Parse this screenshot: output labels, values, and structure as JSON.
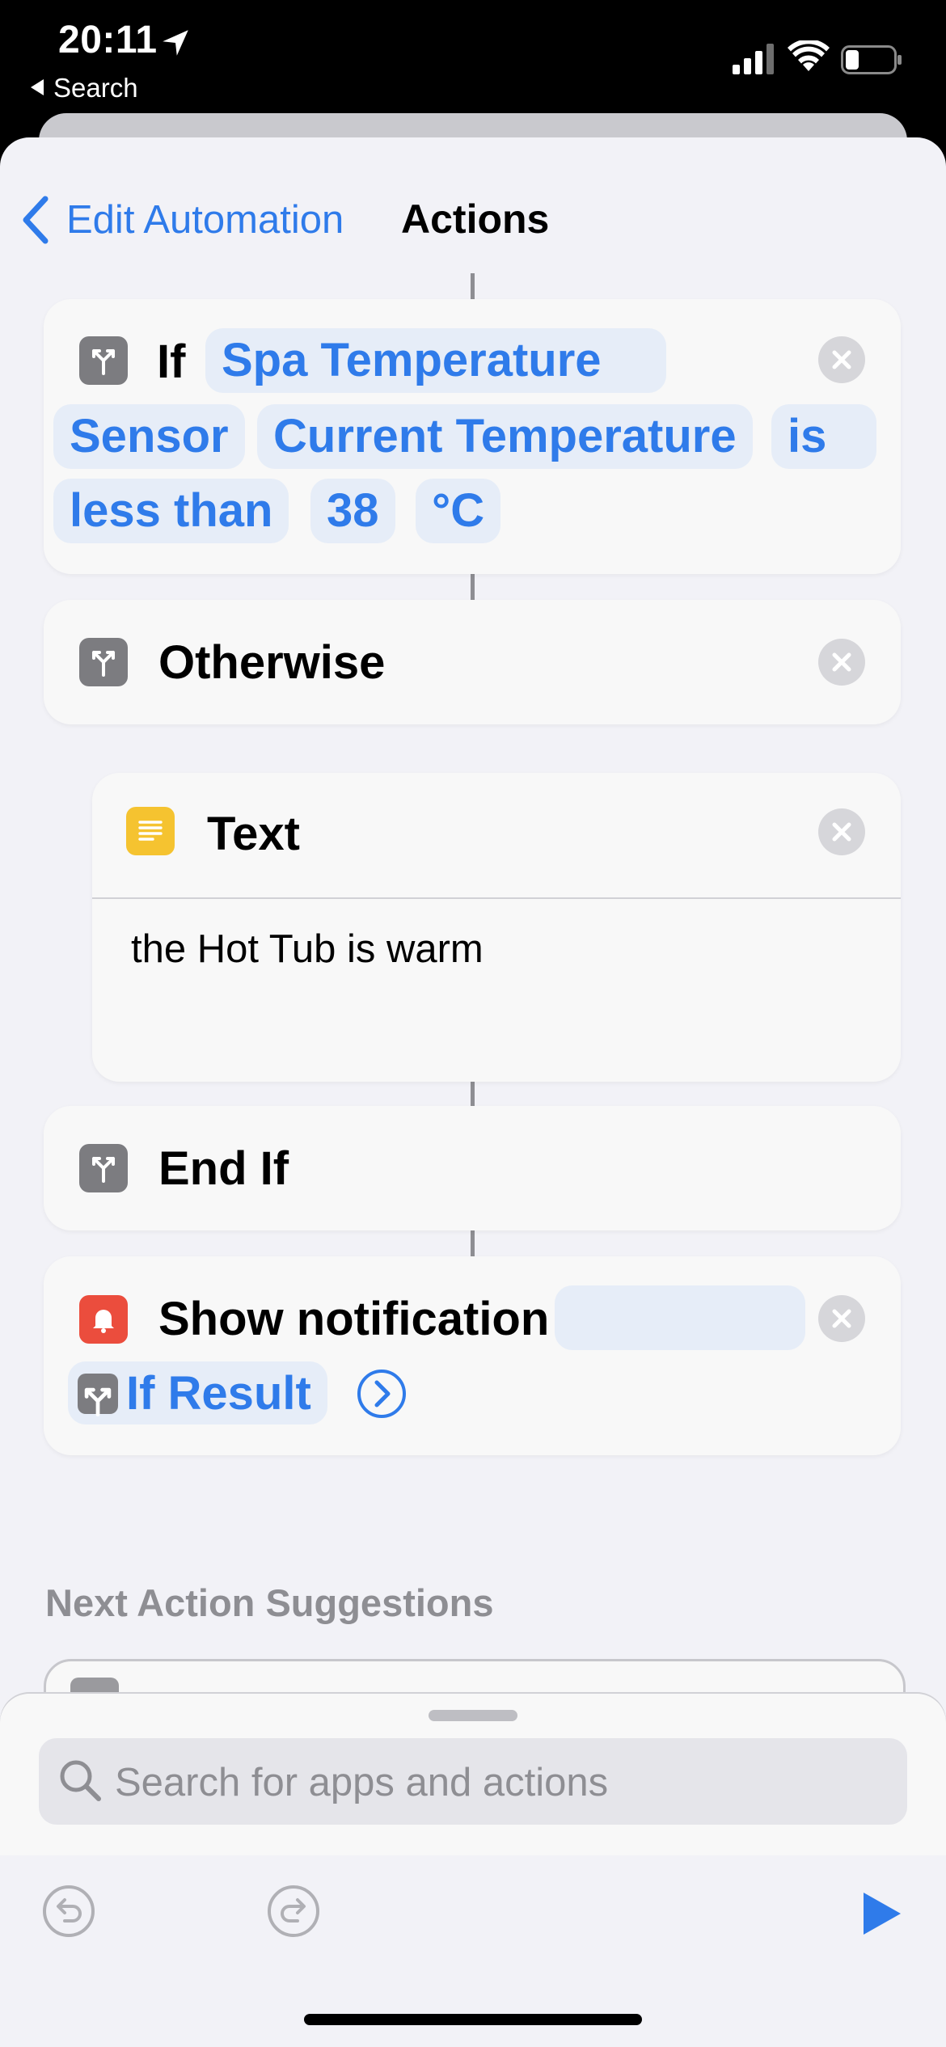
{
  "status_bar": {
    "time": "20:11",
    "back_app": "Search"
  },
  "nav": {
    "back_label": "Edit Automation",
    "title": "Actions"
  },
  "if_block": {
    "keyword": "If",
    "tokens": [
      "Spa Temperature",
      "Sensor",
      "Current Temperature",
      "is",
      "less than",
      "38",
      "°C"
    ]
  },
  "otherwise_block": {
    "label": "Otherwise"
  },
  "text_block": {
    "label": "Text",
    "content": "the Hot Tub is warm"
  },
  "endif_block": {
    "label": "End If"
  },
  "notification_block": {
    "label": "Show notification",
    "variable": "If Result"
  },
  "suggestions": {
    "title": "Next Action Suggestions"
  },
  "search": {
    "placeholder": "Search for apps and actions"
  },
  "colors": {
    "accent": "#2f7bea",
    "notification_red": "#eb4d3d",
    "text_yellow": "#f5c330",
    "control_gray": "#7c7c80"
  }
}
